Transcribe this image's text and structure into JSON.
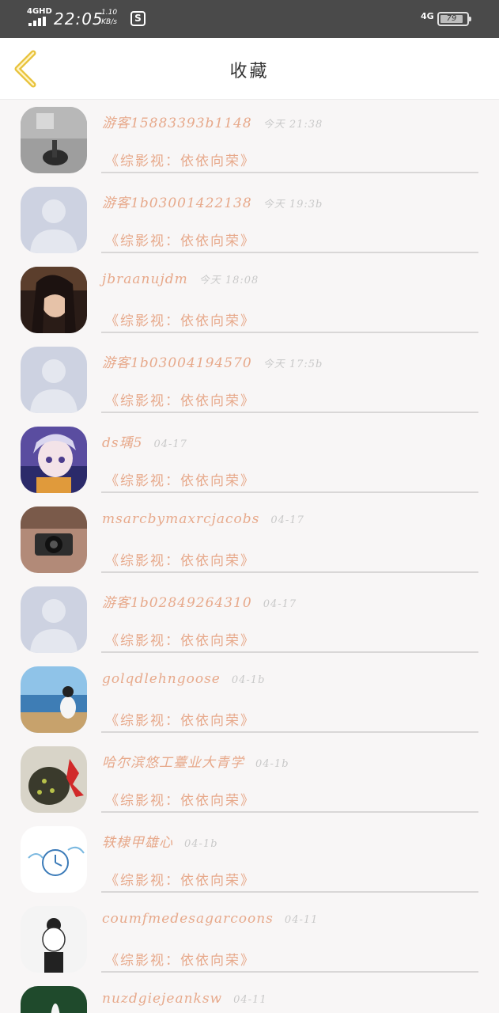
{
  "status_bar": {
    "network": "4GHD",
    "time": "22:05",
    "speed_value": "1.10",
    "speed_unit": "KB/s",
    "app_icon_letter": "S",
    "network_right": "4G",
    "battery": "79"
  },
  "nav": {
    "back_icon": "chevron-left-icon",
    "title": "收藏"
  },
  "colors": {
    "accent": "#e7a98b",
    "back_arrow": "#e8c23a",
    "status_bar_bg": "#4a4a4a"
  },
  "items": [
    {
      "username": "游客15883393b1148",
      "time": "今天  21:38",
      "content": "《综影视：依依向荣》"
    },
    {
      "username": "游客1b03001422138",
      "time": "今天  19:3b",
      "content": "《综影视：依依向荣》"
    },
    {
      "username": "jbraanujdm",
      "time": "今天  18:08",
      "content": "《综影视：依依向荣》"
    },
    {
      "username": "游客1b03004194570",
      "time": "今天  17:5b",
      "content": "《综影视：依依向荣》"
    },
    {
      "username": "ds瑀5",
      "time": "04-17",
      "content": "《综影视：依依向荣》"
    },
    {
      "username": "msarcbymaxrcjacobs",
      "time": "04-17",
      "content": "《综影视：依依向荣》"
    },
    {
      "username": "游客1b02849264310",
      "time": "04-17",
      "content": "《综影视：依依向荣》"
    },
    {
      "username": "golqdlehngoose",
      "time": "04-1b",
      "content": "《综影视：依依向荣》"
    },
    {
      "username": "哈尔滨悠工薹业大青学",
      "time": "04-1b",
      "content": "《综影视：依依向荣》"
    },
    {
      "username": "轶棣甲雄心",
      "time": "04-1b",
      "content": "《综影视：依依向荣》"
    },
    {
      "username": "coumfmedesagarcoons",
      "time": "04-11",
      "content": "《综影视：依依向荣》"
    },
    {
      "username": "nuzdgiejeanksw",
      "time": "04-11",
      "content": ""
    }
  ]
}
